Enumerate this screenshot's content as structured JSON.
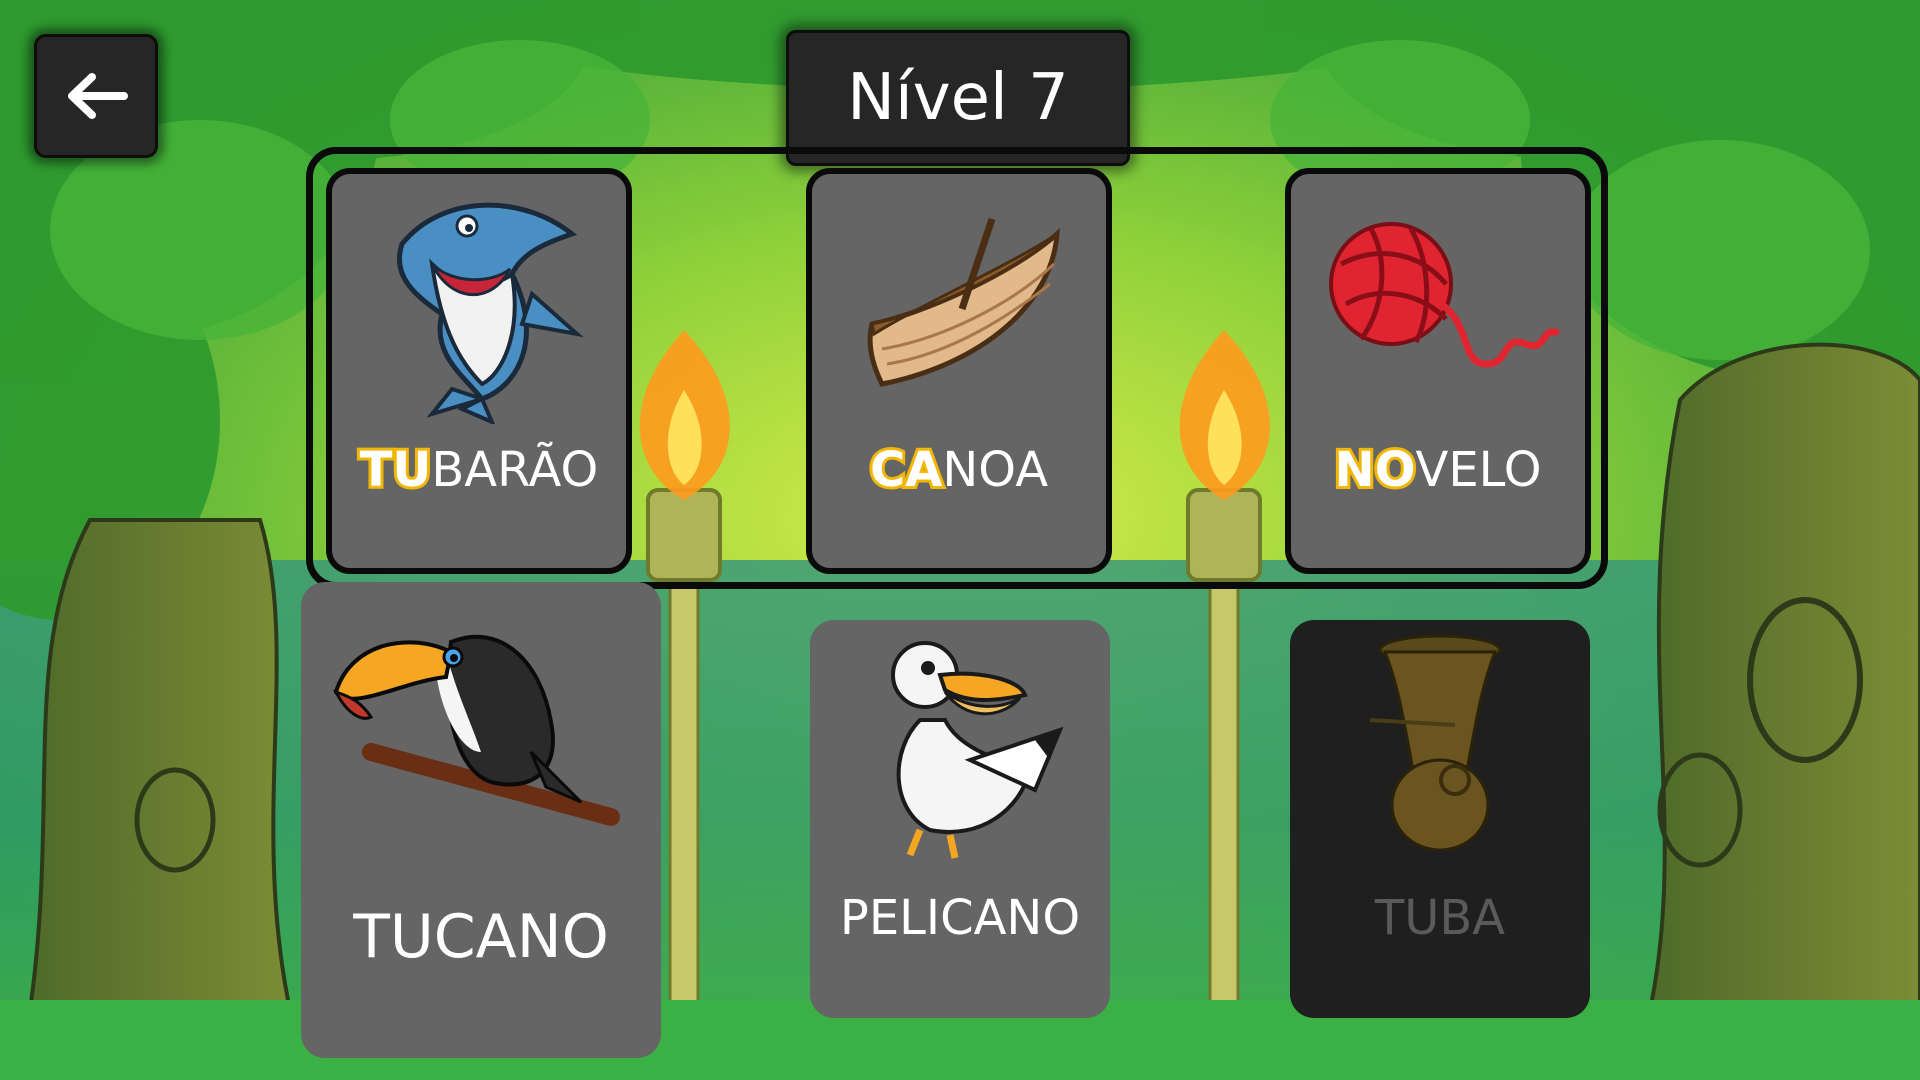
{
  "level": {
    "title": "Nível 7"
  },
  "back_button": {
    "icon": "arrow-left-icon"
  },
  "colors": {
    "highlight": "#f2b705",
    "card": "#656565",
    "card_disabled": "#1f1f1f",
    "frame": "#0a0a0a"
  },
  "target_cards": [
    {
      "highlight": "TU",
      "rest": "BARÃO",
      "image": "shark"
    },
    {
      "highlight": "CA",
      "rest": "NOA",
      "image": "canoe"
    },
    {
      "highlight": "NO",
      "rest": "VELO",
      "image": "yarn-ball"
    }
  ],
  "option_cards": [
    {
      "word": "TUCANO",
      "image": "toucan",
      "state": "selected"
    },
    {
      "word": "PELICANO",
      "image": "pelican",
      "state": "available"
    },
    {
      "word": "TUBA",
      "image": "tuba",
      "state": "disabled"
    }
  ]
}
